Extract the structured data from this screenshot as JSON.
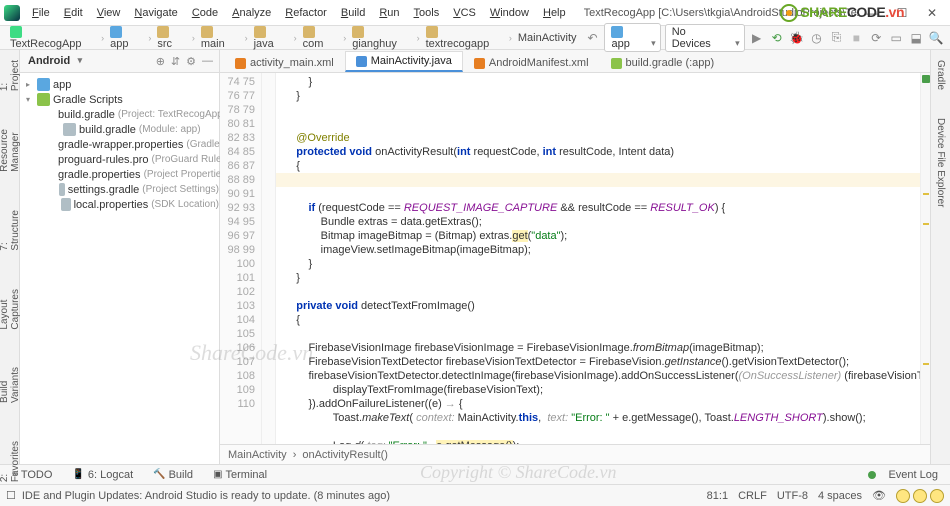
{
  "title": "TextRecogApp [C:\\Users\\tkgia\\AndroidStudioProjects\\TextRecogApp] - ...\\textrecogapp\\MainActivity.java [app]",
  "menus": [
    "File",
    "Edit",
    "View",
    "Navigate",
    "Code",
    "Analyze",
    "Refactor",
    "Build",
    "Run",
    "Tools",
    "VCS",
    "Window",
    "Help"
  ],
  "breadcrumbs": [
    "TextRecogApp",
    "app",
    "src",
    "main",
    "java",
    "com",
    "gianghuy",
    "textrecogapp",
    "MainActivity"
  ],
  "run_config": "app",
  "devices": "No Devices",
  "project_view": "Android",
  "tree": {
    "app": "app",
    "scripts": "Gradle Scripts",
    "items": [
      {
        "l": "build.gradle",
        "h": "(Project: TextRecogApp)"
      },
      {
        "l": "build.gradle",
        "h": "(Module: app)"
      },
      {
        "l": "gradle-wrapper.properties",
        "h": "(Gradle Version)"
      },
      {
        "l": "proguard-rules.pro",
        "h": "(ProGuard Rules for app)"
      },
      {
        "l": "gradle.properties",
        "h": "(Project Properties)"
      },
      {
        "l": "settings.gradle",
        "h": "(Project Settings)"
      },
      {
        "l": "local.properties",
        "h": "(SDK Location)"
      }
    ]
  },
  "tabs": [
    {
      "l": "activity_main.xml",
      "t": "xml"
    },
    {
      "l": "MainActivity.java",
      "t": "java",
      "active": true
    },
    {
      "l": "AndroidManifest.xml",
      "t": "xml"
    },
    {
      "l": "build.gradle (:app)",
      "t": "gradle"
    }
  ],
  "line_start": 74,
  "line_end": 110,
  "ed_crumbs": [
    "MainActivity",
    "onActivityResult()"
  ],
  "left_tabs": [
    "1: Project",
    "Resource Manager",
    "7: Structure",
    "Layout Captures",
    "Build Variants",
    "2: Favorites"
  ],
  "right_tabs": [
    "Gradle",
    "Device File Explorer"
  ],
  "bottom_tabs": [
    "TODO",
    "6: Logcat",
    "Build",
    "Terminal"
  ],
  "event_log": "Event Log",
  "status_msg": "IDE and Plugin Updates: Android Studio is ready to update. (8 minutes ago)",
  "status_right": {
    "pos": "81:1",
    "eol": "CRLF",
    "enc": "UTF-8",
    "indent": "4 spaces"
  },
  "watermarks": {
    "sc": "ShareCode.vn",
    "cp": "Copyright © ShareCode.vn"
  },
  "logo": {
    "a": "SHARE",
    "b": "CODE",
    "c": ".vn"
  }
}
